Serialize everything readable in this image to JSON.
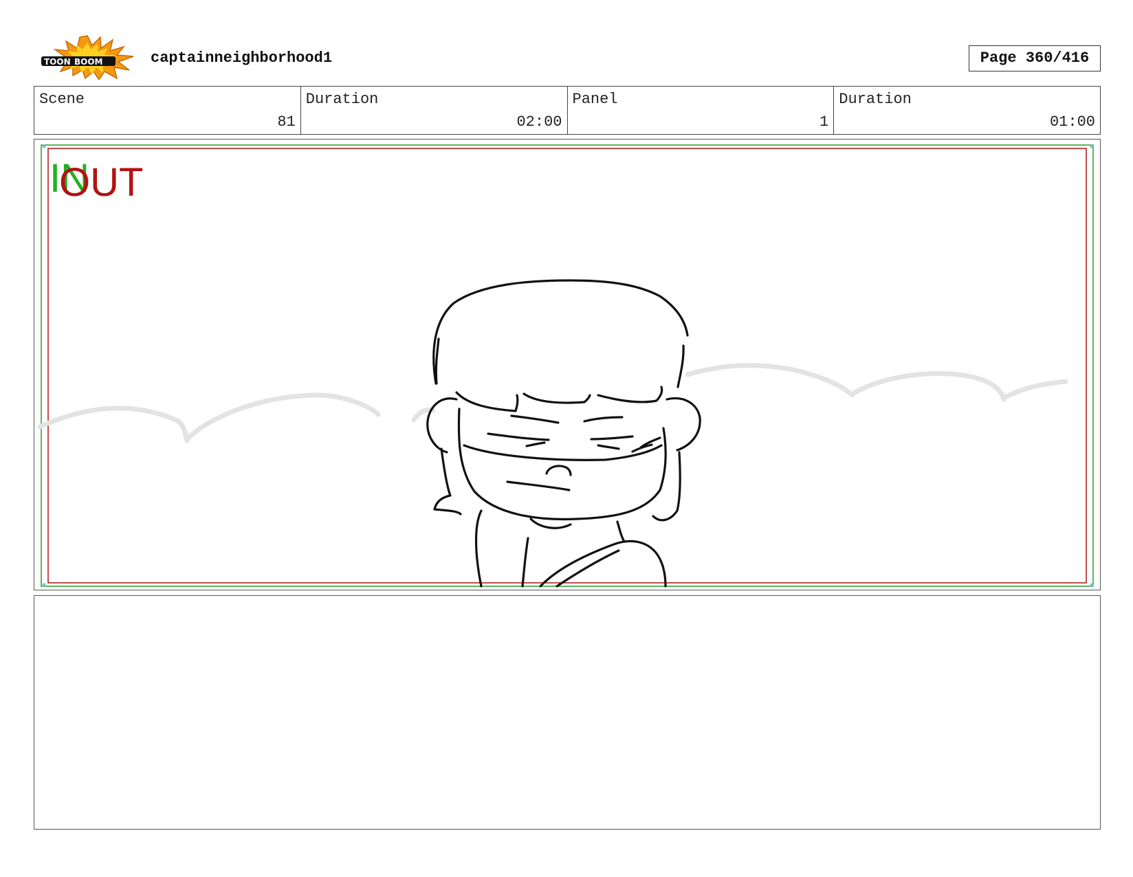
{
  "header": {
    "logo_text_left": "TOON",
    "logo_text_right": "BOOM",
    "project_title": "captainneighborhood1",
    "page_label": "Page 360/416"
  },
  "info": {
    "scene_label": "Scene",
    "scene_value": "81",
    "scene_duration_label": "Duration",
    "scene_duration_value": "02:00",
    "panel_label": "Panel",
    "panel_value": "1",
    "panel_duration_label": "Duration",
    "panel_duration_value": "01:00"
  },
  "panel": {
    "in_marker": "IN",
    "out_marker": "OUT",
    "safe_frame_green": "#22a022",
    "safe_frame_red": "#b31212"
  },
  "notes": {
    "text": ""
  },
  "colors": {
    "logo_orange": "#f39a12",
    "logo_yellow": "#ffd21f",
    "logo_black": "#111111"
  }
}
